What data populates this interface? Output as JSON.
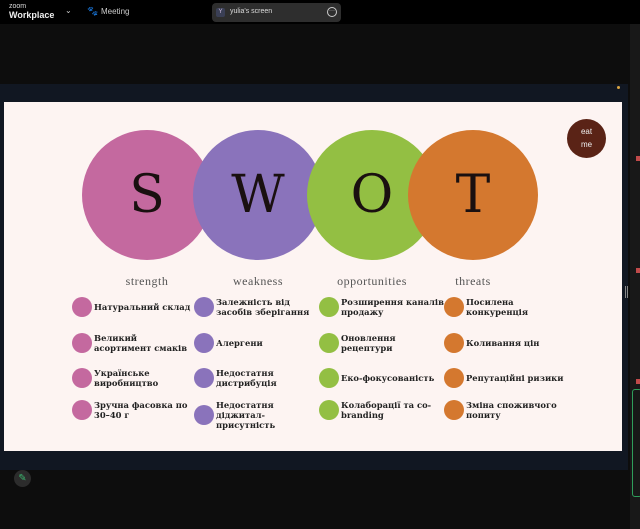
{
  "topbar": {
    "logo_small": "zoom",
    "logo_big": "Workplace",
    "meeting_label": "Meeting",
    "screen_initial": "Y",
    "screen_name": "yulia's screen"
  },
  "slide": {
    "badge": [
      "eat",
      "me"
    ],
    "columns": [
      {
        "letter": "S",
        "label": "strength",
        "color": "#c4699f",
        "items": [
          "Натуральний склад",
          "Великий асортимент смаків",
          "Українське виробництво",
          "Зручна фасовка по 30–40 г"
        ]
      },
      {
        "letter": "W",
        "label": "weakness",
        "color": "#8a73bb",
        "items": [
          "Залежність від засобів зберігання",
          "Алергени",
          "Недостатня дистрибуція",
          "Недостатня діджитал-присутність"
        ]
      },
      {
        "letter": "O",
        "label": "opportunities",
        "color": "#93bf43",
        "items": [
          "Розширення каналів продажу",
          "Оновлення рецептури",
          "Еко-фокусованість",
          "Колаборації та co-branding"
        ]
      },
      {
        "letter": "T",
        "label": "threats",
        "color": "#d4782f",
        "items": [
          "Посилена конкуренція",
          "Коливання цін",
          "Репутаційні ризики",
          "Зміна споживчого попиту"
        ]
      }
    ]
  }
}
